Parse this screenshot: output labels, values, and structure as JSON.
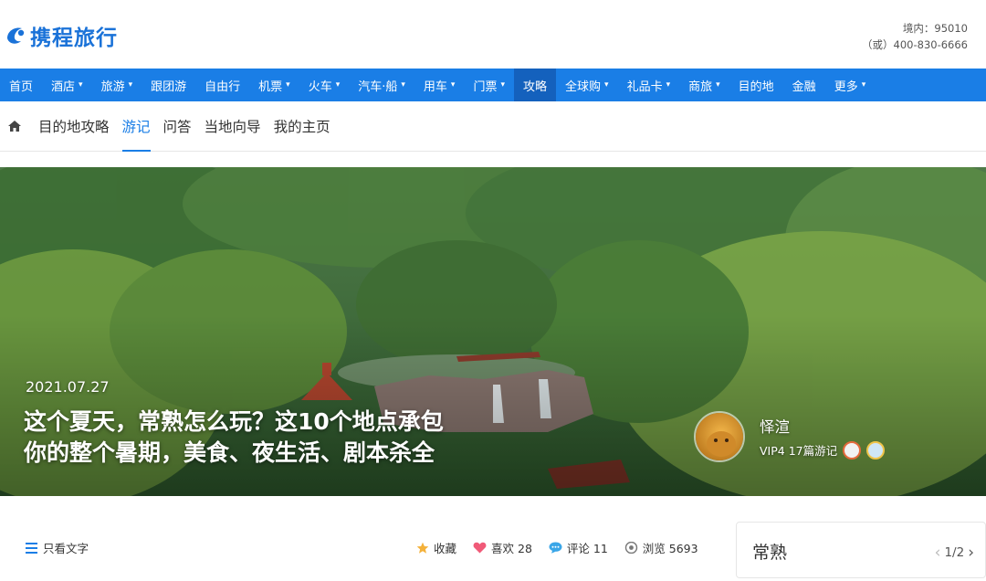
{
  "brand": {
    "name": "携程旅行"
  },
  "hotline": {
    "line1": "境内：95010",
    "line2": "（或）400-830-6666"
  },
  "nav": {
    "items": [
      {
        "label": "首页",
        "caret": ""
      },
      {
        "label": "酒店",
        "caret": "▾"
      },
      {
        "label": "旅游",
        "caret": "▾"
      },
      {
        "label": "跟团游",
        "caret": ""
      },
      {
        "label": "自由行",
        "caret": ""
      },
      {
        "label": "机票",
        "caret": "▾"
      },
      {
        "label": "火车",
        "caret": "▾"
      },
      {
        "label": "汽车·船",
        "caret": "▾"
      },
      {
        "label": "用车",
        "caret": "▾"
      },
      {
        "label": "门票",
        "caret": "▾"
      },
      {
        "label": "攻略",
        "caret": ""
      },
      {
        "label": "全球购",
        "caret": "▾"
      },
      {
        "label": "礼品卡",
        "caret": "▾"
      },
      {
        "label": "商旅",
        "caret": "▾"
      },
      {
        "label": "目的地",
        "caret": ""
      },
      {
        "label": "金融",
        "caret": ""
      },
      {
        "label": "更多",
        "caret": "▾"
      }
    ],
    "active": "攻略"
  },
  "subnav": {
    "items": [
      "目的地攻略",
      "游记",
      "问答",
      "当地向导",
      "我的主页"
    ],
    "active": "游记"
  },
  "hero": {
    "date": "2021.07.27",
    "title_line1": "这个夏天，常熟怎么玩？这10个地点承包",
    "title_line2": "你的整个暑期，美食、夜生活、剧本杀全",
    "author": {
      "name": "怿渲",
      "meta": "VIP4  17篇游记"
    }
  },
  "toolbar": {
    "text_only": "只看文字",
    "favorite": "收藏",
    "like": "喜欢 28",
    "comment": "评论 11",
    "views": "浏览 5693"
  },
  "side_card": {
    "title": "常熟",
    "page": "1/2",
    "prev": "‹",
    "next": "›"
  },
  "colors": {
    "brand_blue": "#1a7ee6",
    "nav_active": "#1461bd"
  }
}
